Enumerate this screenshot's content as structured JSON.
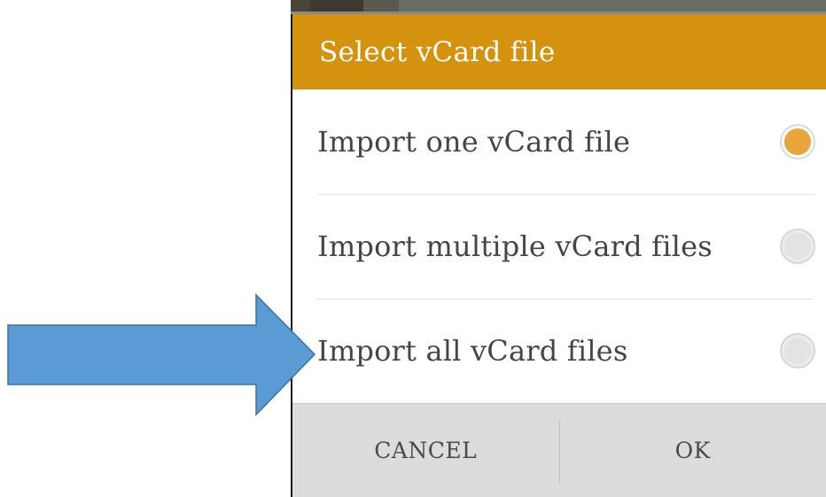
{
  "dialog": {
    "title": "Select vCard file",
    "options": [
      {
        "label": "Import one vCard file",
        "selected": true
      },
      {
        "label": "Import multiple vCard files",
        "selected": false
      },
      {
        "label": "Import all vCard files",
        "selected": false
      }
    ],
    "buttons": {
      "cancel": "CANCEL",
      "ok": "OK"
    }
  },
  "annotation": {
    "arrow_icon": "right-arrow-icon",
    "arrow_color": "#5b9bd5",
    "arrow_target": "Import all vCard files"
  },
  "colors": {
    "header": "#d5920f",
    "radio_selected": "#e9a43d",
    "footer": "#dcdcdc"
  }
}
